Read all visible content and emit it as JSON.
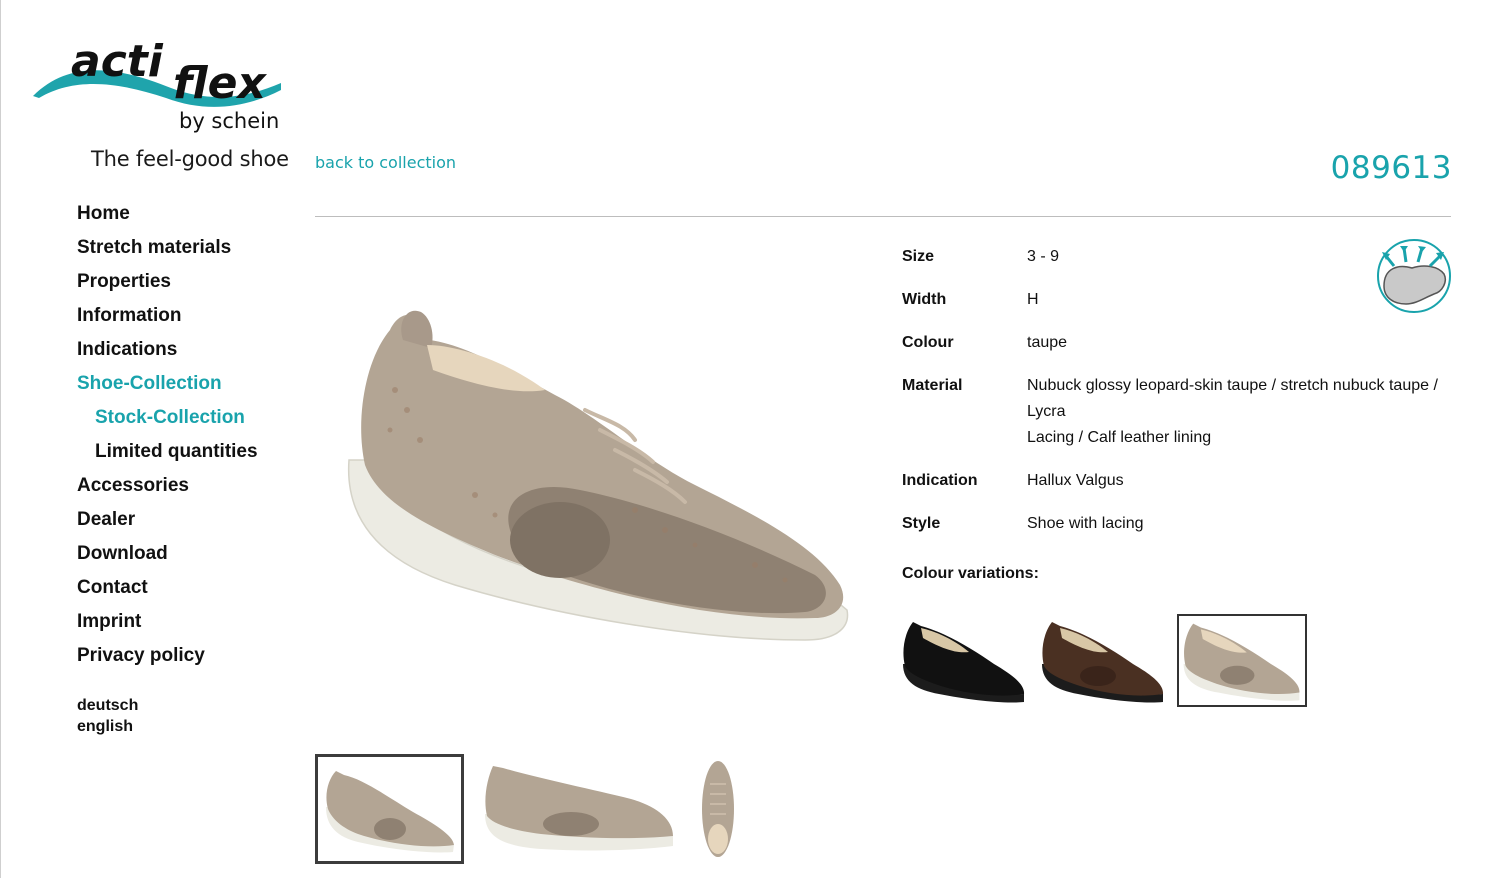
{
  "brand": {
    "logo_word_1": "acti",
    "logo_word_2": "flex",
    "logo_sub": "by schein",
    "tagline": "The feel-good shoe"
  },
  "nav": {
    "items": [
      {
        "label": "Home"
      },
      {
        "label": "Stretch materials"
      },
      {
        "label": "Properties"
      },
      {
        "label": "Information"
      },
      {
        "label": "Indications"
      },
      {
        "label": "Shoe-Collection"
      },
      {
        "label": "Stock-Collection"
      },
      {
        "label": "Limited quantities"
      },
      {
        "label": "Accessories"
      },
      {
        "label": "Dealer"
      },
      {
        "label": "Download"
      },
      {
        "label": "Contact"
      },
      {
        "label": "Imprint"
      },
      {
        "label": "Privacy policy"
      }
    ],
    "languages": [
      "deutsch",
      "english"
    ]
  },
  "product": {
    "back_link": "back to collection",
    "article_number": "089613",
    "specs": {
      "size_label": "Size",
      "size": "3 - 9",
      "width_label": "Width",
      "width": "H",
      "colour_label": "Colour",
      "colour": "taupe",
      "material_label": "Material",
      "material_line_1": "Nubuck glossy leopard-skin taupe / stretch nubuck taupe / Lycra",
      "material_line_2": "Lacing / Calf leather lining",
      "indication_label": "Indication",
      "indication": "Hallux Valgus",
      "style_label": "Style",
      "style": "Shoe with lacing"
    },
    "colour_variations_label": "Colour variations:",
    "variations": [
      "black",
      "brown",
      "taupe"
    ],
    "selected_variation": "taupe",
    "selected_thumbnail": 1
  },
  "colors": {
    "accent": "#19a3ac",
    "text": "#111111",
    "taupe": "#b3a594",
    "sole": "#ecebe3"
  }
}
